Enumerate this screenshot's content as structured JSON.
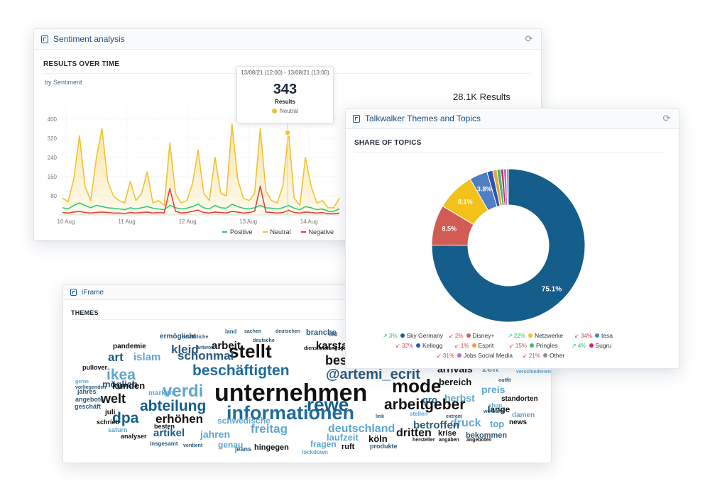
{
  "sentiment": {
    "title": "Sentiment analysis",
    "section": "RESULTS OVER TIME",
    "by": "by Sentiment",
    "total": "28.1K Results",
    "tooltip": {
      "range": "13/08/21 (12:00) - 13/08/21 (13:00)",
      "value": "343",
      "label": "Results",
      "series": "Neutral"
    },
    "legend": [
      {
        "label": "Positive",
        "color": "#2ecc71"
      },
      {
        "label": "Neutral",
        "color": "#f1c232"
      },
      {
        "label": "Negative",
        "color": "#e0413f"
      }
    ]
  },
  "chart_data": [
    {
      "type": "area",
      "categories": [
        "10 Aug",
        "11 Aug",
        "12 Aug",
        "13 Aug",
        "14 Aug"
      ],
      "yticks": [
        "80",
        "160",
        "240",
        "320",
        "400"
      ],
      "ylim": [
        0,
        420
      ],
      "xlabel": "",
      "ylabel": "",
      "series": [
        {
          "name": "Neutral",
          "color": "#f1c232",
          "values": [
            70,
            55,
            150,
            330,
            120,
            60,
            240,
            360,
            140,
            80,
            60,
            50,
            140,
            60,
            90,
            180,
            50,
            60,
            40,
            300,
            90,
            50,
            60,
            130,
            270,
            90,
            60,
            240,
            90,
            80,
            380,
            150,
            70,
            60,
            90,
            360,
            100,
            60,
            50,
            120,
            350,
            70,
            40,
            240,
            120,
            50,
            60,
            30,
            30,
            70
          ]
        },
        {
          "name": "Positive",
          "color": "#2ecc71",
          "values": [
            30,
            25,
            40,
            50,
            40,
            30,
            40,
            35,
            30,
            28,
            25,
            22,
            30,
            25,
            30,
            35,
            28,
            25,
            22,
            40,
            30,
            25,
            28,
            35,
            45,
            30,
            25,
            40,
            30,
            28,
            45,
            35,
            28,
            25,
            30,
            40,
            30,
            28,
            25,
            30,
            40,
            28,
            22,
            35,
            30,
            22,
            25,
            15,
            15,
            25
          ]
        },
        {
          "name": "Negative",
          "color": "#e0413f",
          "values": [
            10,
            8,
            12,
            15,
            10,
            8,
            10,
            12,
            10,
            8,
            8,
            6,
            10,
            8,
            10,
            12,
            8,
            10,
            8,
            110,
            15,
            8,
            10,
            15,
            20,
            10,
            8,
            12,
            10,
            8,
            15,
            12,
            8,
            10,
            15,
            120,
            12,
            10,
            8,
            10,
            20,
            10,
            8,
            12,
            10,
            8,
            10,
            5,
            5,
            8
          ]
        }
      ]
    },
    {
      "type": "pie",
      "title": "SHARE OF TOPICS",
      "slices": [
        {
          "name": "Sky Germany",
          "value": 75.1,
          "color": "#155d8b",
          "label": "75.1%"
        },
        {
          "name": "Disney+",
          "value": 8.5,
          "color": "#d35b55",
          "label": "8.5%"
        },
        {
          "name": "Netzwerke",
          "value": 8.1,
          "color": "#f2c21b",
          "label": "8.1%"
        },
        {
          "name": "tesa",
          "value": 3.8,
          "color": "#4e7fc3",
          "label": "3.8%"
        },
        {
          "name": "Kellogg",
          "value": 1.2,
          "color": "#2a55b5",
          "label": ""
        },
        {
          "name": "Esprit",
          "value": 0.9,
          "color": "#f0a03c",
          "label": ""
        },
        {
          "name": "Pringles",
          "value": 0.8,
          "color": "#3cba6f",
          "label": ""
        },
        {
          "name": "Sugru",
          "value": 0.6,
          "color": "#e01f6a",
          "label": ""
        },
        {
          "name": "Jobs Social Media",
          "value": 0.6,
          "color": "#b56ad0",
          "label": ""
        },
        {
          "name": "Other",
          "value": 0.4,
          "color": "#8a8f96",
          "label": ""
        }
      ]
    }
  ],
  "topics": {
    "title": "Talkwalker Themes and Topics",
    "section": "SHARE OF TOPICS",
    "legend": [
      {
        "change": "3%",
        "dir": "up",
        "name": "Sky Germany",
        "color": "#155d8b"
      },
      {
        "change": "2%",
        "dir": "down",
        "name": "Disney+",
        "color": "#d35b55"
      },
      {
        "change": "22%",
        "dir": "up",
        "name": "Netzwerke",
        "color": "#f2c21b"
      },
      {
        "change": "34%",
        "dir": "down",
        "name": "tesa",
        "color": "#4e7fc3"
      },
      {
        "change": "32%",
        "dir": "down",
        "name": "Kellogg",
        "color": "#2a55b5"
      },
      {
        "change": "1%",
        "dir": "down",
        "name": "Esprit",
        "color": "#f0a03c"
      },
      {
        "change": "15%",
        "dir": "down",
        "name": "Pringles",
        "color": "#3cba6f"
      },
      {
        "change": "4%",
        "dir": "up",
        "name": "Sugru",
        "color": "#e01f6a"
      },
      {
        "change": "31%",
        "dir": "down",
        "name": "Jobs Social Media",
        "color": "#b56ad0"
      },
      {
        "change": "21%",
        "dir": "down",
        "name": "Other",
        "color": "#8a8f96"
      }
    ]
  },
  "iframe": {
    "title": "iFrame",
    "section": "THEMES",
    "words": [
      {
        "t": "unternehmen",
        "s": 34,
        "c": "#111111"
      },
      {
        "t": "informationen",
        "s": 27,
        "c": "#1f6b9a"
      },
      {
        "t": "stellt",
        "s": 26,
        "c": "#111111"
      },
      {
        "t": "mode",
        "s": 26,
        "c": "#111111"
      },
      {
        "t": "rewe",
        "s": 26,
        "c": "#155d8b"
      },
      {
        "t": "verdi",
        "s": 24,
        "c": "#5fa6cf"
      },
      {
        "t": "beschäftigten",
        "s": 21,
        "c": "#1f6b9a"
      },
      {
        "t": "@artemi_ecrit",
        "s": 20,
        "c": "#2b5a7c"
      },
      {
        "t": "arbeitgeber",
        "s": 21,
        "c": "#111111"
      },
      {
        "t": "abteilung",
        "s": 21,
        "c": "#155d8b"
      },
      {
        "t": "ikea",
        "s": 21,
        "c": "#5fa6cf"
      },
      {
        "t": "dpa",
        "s": 21,
        "c": "#155d8b"
      },
      {
        "t": "welt",
        "s": 18,
        "c": "#111111"
      },
      {
        "t": "beschäftigten",
        "s": 18,
        "c": "#111111"
      },
      {
        "t": "deutschland",
        "s": 16,
        "c": "#5fa6cf"
      },
      {
        "t": "schonmal",
        "s": 17,
        "c": "#2b5a7c"
      },
      {
        "t": "kleid",
        "s": 17,
        "c": "#2b5a7c"
      },
      {
        "t": "karstadt",
        "s": 15,
        "c": "#111111"
      },
      {
        "t": "erhöhen",
        "s": 17,
        "c": "#111111"
      },
      {
        "t": "freitag",
        "s": 17,
        "c": "#5fa6cf"
      },
      {
        "t": "art",
        "s": 17,
        "c": "#155d8b"
      },
      {
        "t": "islam",
        "s": 15,
        "c": "#5fa6cf"
      },
      {
        "t": "arbeit",
        "s": 15,
        "c": "#111111"
      },
      {
        "t": "druck",
        "s": 16,
        "c": "#5fa6cf"
      },
      {
        "t": "betroffen",
        "s": 15,
        "c": "#2b5a7c"
      },
      {
        "t": "dritten",
        "s": 16,
        "c": "#111111"
      },
      {
        "t": "artikel",
        "s": 15,
        "c": "#155d8b"
      },
      {
        "t": "jahren",
        "s": 14,
        "c": "#5fa6cf"
      },
      {
        "t": "herbst",
        "s": 14,
        "c": "#5fa6cf"
      },
      {
        "t": "preis",
        "s": 14,
        "c": "#5fa6cf"
      },
      {
        "t": "zeit",
        "s": 14,
        "c": "#5fa6cf"
      },
      {
        "t": "arrivals",
        "s": 14,
        "c": "#111111"
      },
      {
        "t": "bereich",
        "s": 13,
        "c": "#111111"
      },
      {
        "t": "laufzeit",
        "s": 13,
        "c": "#5fa6cf"
      },
      {
        "t": "köln",
        "s": 13,
        "c": "#111111"
      },
      {
        "t": "möglich",
        "s": 13,
        "c": "#2b5a7c"
      },
      {
        "t": "kunden",
        "s": 13,
        "c": "#111111"
      },
      {
        "t": "schwedische",
        "s": 12,
        "c": "#5fa6cf"
      },
      {
        "t": "fragen",
        "s": 12,
        "c": "#5fa6cf"
      },
      {
        "t": "genau",
        "s": 12,
        "c": "#5fa6cf"
      },
      {
        "t": "lange",
        "s": 12,
        "c": "#111111"
      },
      {
        "t": "top",
        "s": 13,
        "c": "#5fa6cf"
      },
      {
        "t": "krise",
        "s": 11,
        "c": "#111111"
      },
      {
        "t": "bekommen",
        "s": 11,
        "c": "#2b5a7c"
      },
      {
        "t": "hingegen",
        "s": 11,
        "c": "#111111"
      },
      {
        "t": "ruft",
        "s": 11,
        "c": "#111111"
      },
      {
        "t": "pandemie",
        "s": 10,
        "c": "#111111"
      },
      {
        "t": "standorten",
        "s": 10,
        "c": "#111111"
      },
      {
        "t": "damen",
        "s": 10,
        "c": "#5fa6cf"
      },
      {
        "t": "news",
        "s": 10,
        "c": "#111111"
      },
      {
        "t": "juli",
        "s": 10,
        "c": "#111111"
      },
      {
        "t": "jahres",
        "s": 9,
        "c": "#2b5a7c"
      },
      {
        "t": "geschäft",
        "s": 9,
        "c": "#2b5a7c"
      },
      {
        "t": "angebote",
        "s": 9,
        "c": "#2b5a7c"
      },
      {
        "t": "analyser",
        "s": 9,
        "c": "#111111"
      },
      {
        "t": "saturn",
        "s": 9,
        "c": "#5fa6cf"
      },
      {
        "t": "schrieb",
        "s": 9,
        "c": "#111111"
      },
      {
        "t": "insgesamt",
        "s": 8,
        "c": "#2b5a7c"
      },
      {
        "t": "verdient",
        "s": 7,
        "c": "#2b5a7c"
      },
      {
        "t": "jeans",
        "s": 9,
        "c": "#2b5a7c"
      },
      {
        "t": "lockdown",
        "s": 8,
        "c": "#5fa6cf"
      },
      {
        "t": "produkte",
        "s": 9,
        "c": "#2b5a7c"
      },
      {
        "t": "hersteller",
        "s": 7,
        "c": "#111111"
      },
      {
        "t": "angaben",
        "s": 7,
        "c": "#111111"
      },
      {
        "t": "angeboten",
        "s": 7,
        "c": "#111111"
      },
      {
        "t": "pullover",
        "s": 9,
        "c": "#111111"
      },
      {
        "t": "besten",
        "s": 9,
        "c": "#111111"
      },
      {
        "t": "marken",
        "s": 10,
        "c": "#5fa6cf"
      },
      {
        "t": "gerne",
        "s": 7,
        "c": "#5fa6cf"
      },
      {
        "t": "vorliegenden",
        "s": 7,
        "c": "#2b5a7c"
      },
      {
        "t": "zusätzliche",
        "s": 7,
        "c": "#2b5a7c"
      },
      {
        "t": "ermöglicht",
        "s": 10,
        "c": "#2b5a7c"
      },
      {
        "t": "antwort",
        "s": 7,
        "c": "#2b5a7c"
      },
      {
        "t": "land",
        "s": 8,
        "c": "#2b5a7c"
      },
      {
        "t": "sachen",
        "s": 7,
        "c": "#2b5a7c"
      },
      {
        "t": "deutschen",
        "s": 7,
        "c": "#2b5a7c"
      },
      {
        "t": "branche",
        "s": 11,
        "c": "#2b5a7c"
      },
      {
        "t": "deutsche",
        "s": 7,
        "c": "#2b5a7c"
      },
      {
        "t": "dienstleistungsgewerkschaft",
        "s": 7,
        "c": "#111111"
      },
      {
        "t": "bild",
        "s": 7,
        "c": "#2b5a7c"
      },
      {
        "t": "gro",
        "s": 13,
        "c": "#2b5a7c"
      },
      {
        "t": "outfit",
        "s": 7,
        "c": "#2b5a7c"
      },
      {
        "t": "shop",
        "s": 8,
        "c": "#5fa6cf"
      },
      {
        "t": "werbung",
        "s": 7,
        "c": "#2b5a7c"
      },
      {
        "t": "verschiedenen",
        "s": 7,
        "c": "#5fa6cf"
      },
      {
        "t": "stellen",
        "s": 8,
        "c": "#5fa6cf"
      },
      {
        "t": "extrem",
        "s": 7,
        "c": "#2b5a7c"
      },
      {
        "t": "link",
        "s": 7,
        "c": "#2b5a7c"
      }
    ]
  }
}
